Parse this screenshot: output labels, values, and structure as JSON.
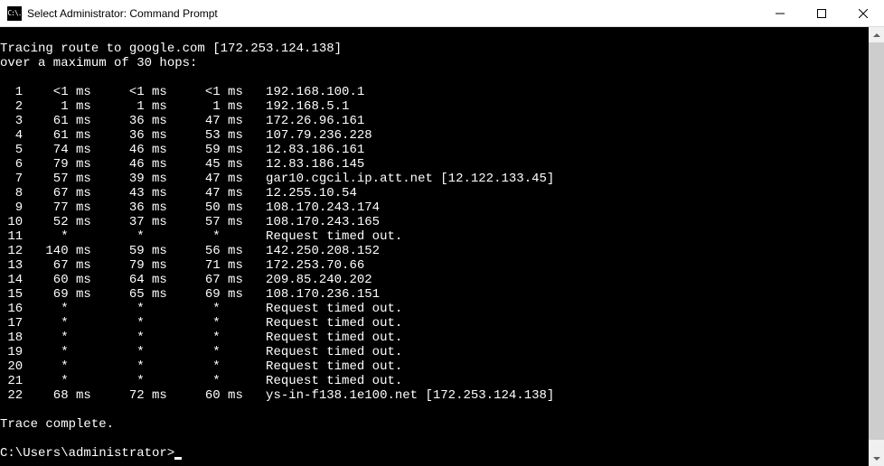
{
  "window": {
    "title": "Select Administrator: Command Prompt",
    "icon_text": "C:\\."
  },
  "trace": {
    "header_line1": "Tracing route to google.com [172.253.124.138]",
    "header_line2": "over a maximum of 30 hops:",
    "complete": "Trace complete.",
    "hops": [
      {
        "n": "1",
        "r1": "<1",
        "u1": "ms",
        "r2": "<1",
        "u2": "ms",
        "r3": "<1",
        "u3": "ms",
        "dest": "192.168.100.1"
      },
      {
        "n": "2",
        "r1": "1",
        "u1": "ms",
        "r2": "1",
        "u2": "ms",
        "r3": "1",
        "u3": "ms",
        "dest": "192.168.5.1"
      },
      {
        "n": "3",
        "r1": "61",
        "u1": "ms",
        "r2": "36",
        "u2": "ms",
        "r3": "47",
        "u3": "ms",
        "dest": "172.26.96.161"
      },
      {
        "n": "4",
        "r1": "61",
        "u1": "ms",
        "r2": "36",
        "u2": "ms",
        "r3": "53",
        "u3": "ms",
        "dest": "107.79.236.228"
      },
      {
        "n": "5",
        "r1": "74",
        "u1": "ms",
        "r2": "46",
        "u2": "ms",
        "r3": "59",
        "u3": "ms",
        "dest": "12.83.186.161"
      },
      {
        "n": "6",
        "r1": "79",
        "u1": "ms",
        "r2": "46",
        "u2": "ms",
        "r3": "45",
        "u3": "ms",
        "dest": "12.83.186.145"
      },
      {
        "n": "7",
        "r1": "57",
        "u1": "ms",
        "r2": "39",
        "u2": "ms",
        "r3": "47",
        "u3": "ms",
        "dest": "gar10.cgcil.ip.att.net [12.122.133.45]"
      },
      {
        "n": "8",
        "r1": "67",
        "u1": "ms",
        "r2": "43",
        "u2": "ms",
        "r3": "47",
        "u3": "ms",
        "dest": "12.255.10.54"
      },
      {
        "n": "9",
        "r1": "77",
        "u1": "ms",
        "r2": "36",
        "u2": "ms",
        "r3": "50",
        "u3": "ms",
        "dest": "108.170.243.174"
      },
      {
        "n": "10",
        "r1": "52",
        "u1": "ms",
        "r2": "37",
        "u2": "ms",
        "r3": "57",
        "u3": "ms",
        "dest": "108.170.243.165"
      },
      {
        "n": "11",
        "r1": "*",
        "u1": "",
        "r2": "*",
        "u2": "",
        "r3": "*",
        "u3": "",
        "dest": "Request timed out."
      },
      {
        "n": "12",
        "r1": "140",
        "u1": "ms",
        "r2": "59",
        "u2": "ms",
        "r3": "56",
        "u3": "ms",
        "dest": "142.250.208.152"
      },
      {
        "n": "13",
        "r1": "67",
        "u1": "ms",
        "r2": "79",
        "u2": "ms",
        "r3": "71",
        "u3": "ms",
        "dest": "172.253.70.66"
      },
      {
        "n": "14",
        "r1": "60",
        "u1": "ms",
        "r2": "64",
        "u2": "ms",
        "r3": "67",
        "u3": "ms",
        "dest": "209.85.240.202"
      },
      {
        "n": "15",
        "r1": "69",
        "u1": "ms",
        "r2": "65",
        "u2": "ms",
        "r3": "69",
        "u3": "ms",
        "dest": "108.170.236.151"
      },
      {
        "n": "16",
        "r1": "*",
        "u1": "",
        "r2": "*",
        "u2": "",
        "r3": "*",
        "u3": "",
        "dest": "Request timed out."
      },
      {
        "n": "17",
        "r1": "*",
        "u1": "",
        "r2": "*",
        "u2": "",
        "r3": "*",
        "u3": "",
        "dest": "Request timed out."
      },
      {
        "n": "18",
        "r1": "*",
        "u1": "",
        "r2": "*",
        "u2": "",
        "r3": "*",
        "u3": "",
        "dest": "Request timed out."
      },
      {
        "n": "19",
        "r1": "*",
        "u1": "",
        "r2": "*",
        "u2": "",
        "r3": "*",
        "u3": "",
        "dest": "Request timed out."
      },
      {
        "n": "20",
        "r1": "*",
        "u1": "",
        "r2": "*",
        "u2": "",
        "r3": "*",
        "u3": "",
        "dest": "Request timed out."
      },
      {
        "n": "21",
        "r1": "*",
        "u1": "",
        "r2": "*",
        "u2": "",
        "r3": "*",
        "u3": "",
        "dest": "Request timed out."
      },
      {
        "n": "22",
        "r1": "68",
        "u1": "ms",
        "r2": "72",
        "u2": "ms",
        "r3": "60",
        "u3": "ms",
        "dest": "ys-in-f138.1e100.net [172.253.124.138]"
      }
    ]
  },
  "prompt": {
    "text": "C:\\Users\\administrator>"
  }
}
